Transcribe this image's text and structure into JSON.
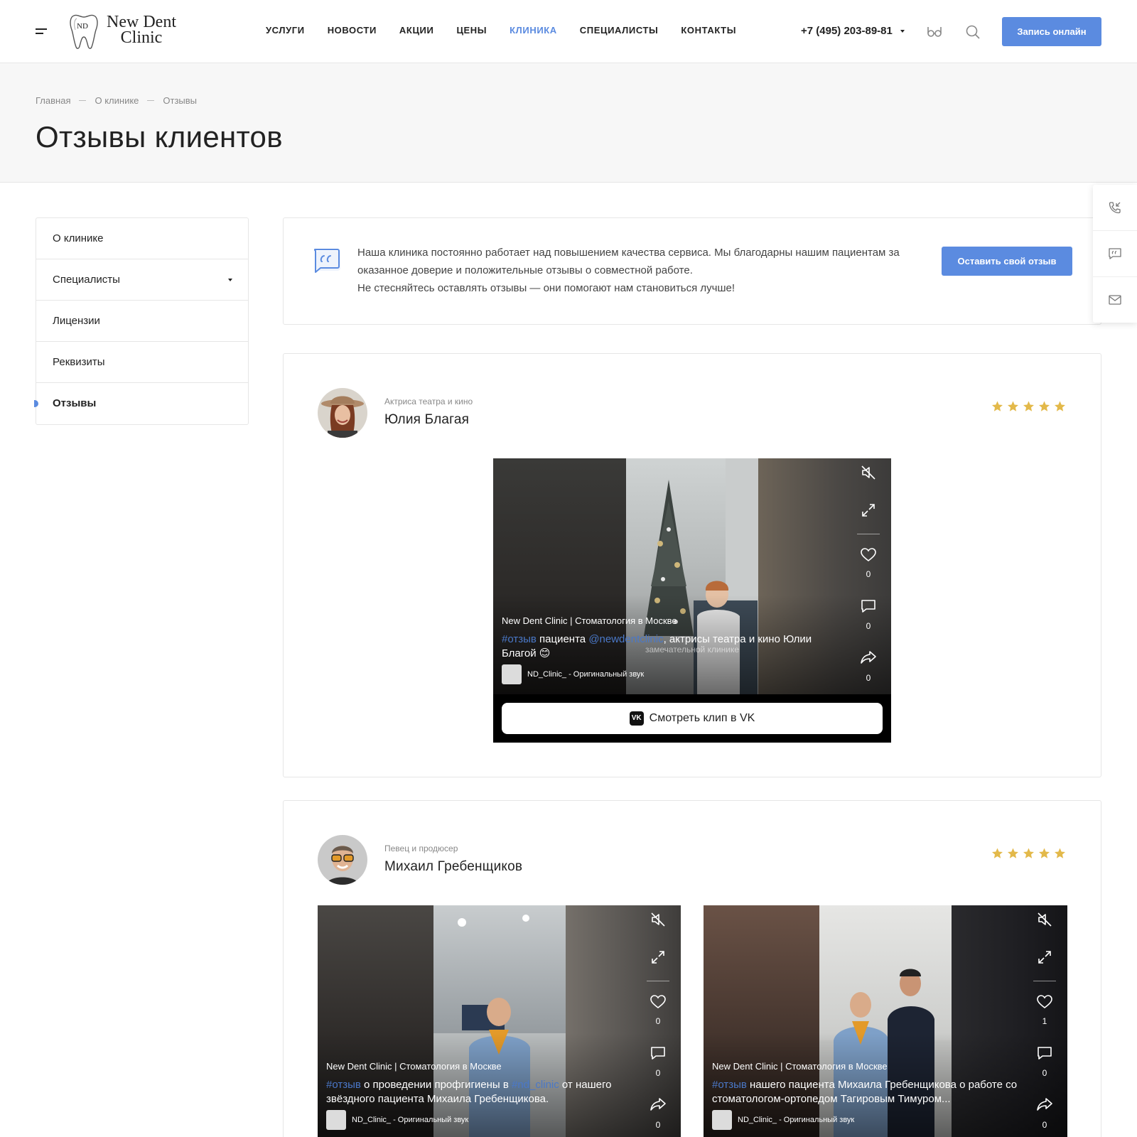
{
  "header": {
    "logo_monogram": "ND",
    "logo_line1": "New Dent",
    "logo_line2": "Clinic",
    "nav": [
      "УСЛУГИ",
      "НОВОСТИ",
      "АКЦИИ",
      "ЦЕНЫ",
      "КЛИНИКА",
      "СПЕЦИАЛИСТЫ",
      "КОНТАКТЫ"
    ],
    "nav_active_index": 4,
    "phone": "+7 (495) 203-89-81",
    "cta": "Запись онлайн"
  },
  "breadcrumb": [
    "Главная",
    "О клинике",
    "Отзывы"
  ],
  "page_title": "Отзывы клиентов",
  "sidebar": {
    "items": [
      {
        "label": "О клинике"
      },
      {
        "label": "Специалисты",
        "has_caret": true
      },
      {
        "label": "Лицензии"
      },
      {
        "label": "Реквизиты"
      },
      {
        "label": "Отзывы",
        "active": true
      }
    ]
  },
  "intro": {
    "line1": "Наша клиника постоянно работает над повышением качества сервиса. Мы благодарны нашим пациентам за оказанное доверие и положительные отзывы о совместной работе.",
    "line2": "Не стесняйтесь оставлять отзывы — они помогают нам становиться лучше!",
    "button": "Оставить свой отзыв"
  },
  "float_panel": [
    "callback-icon",
    "chat-icon",
    "mail-icon"
  ],
  "reviews": [
    {
      "role": "Актриса театра и кино",
      "name": "Юлия Благая",
      "rating": 5,
      "clips": [
        {
          "channel": "New Dent Clinic | Стоматология в Москве",
          "tag": "#отзыв",
          "caption_a": " пациента ",
          "mention": "@newdentclinic",
          "caption_b": ", актрисы театра и кино Юлии Благой 😊",
          "overlay": "замечательной клинике",
          "sound": "ND_Clinic_ - Оригинальный звук",
          "likes": "0",
          "comments": "0",
          "shares": "0",
          "vk_button": "Смотреть клип в VK"
        }
      ]
    },
    {
      "role": "Певец и продюсер",
      "name": "Михаил Гребенщиков",
      "rating": 5,
      "clips": [
        {
          "channel": "New Dent Clinic | Стоматология в Москве",
          "tag": "#отзыв",
          "caption_a": " о проведении профгигиены в ",
          "mention": "#nd_clinic",
          "caption_b": " от нашего звёздного пациента Михаила Гребенщикова.",
          "sound": "ND_Clinic_ - Оригинальный звук",
          "likes": "0",
          "comments": "0",
          "shares": "0"
        },
        {
          "channel": "New Dent Clinic | Стоматология в Москве",
          "tag": "#отзыв",
          "caption_a": " нашего пациента Михаила Гребенщикова о работе со стоматологом-ортопедом Тагировым Тимуром...",
          "mention": "",
          "caption_b": "",
          "sound": "ND_Clinic_ - Оригинальный звук",
          "likes": "1",
          "comments": "0",
          "shares": "0"
        }
      ]
    }
  ],
  "colors": {
    "accent": "#5b8be0",
    "star": "#e3b94a",
    "hashtag": "#4a78c8"
  }
}
